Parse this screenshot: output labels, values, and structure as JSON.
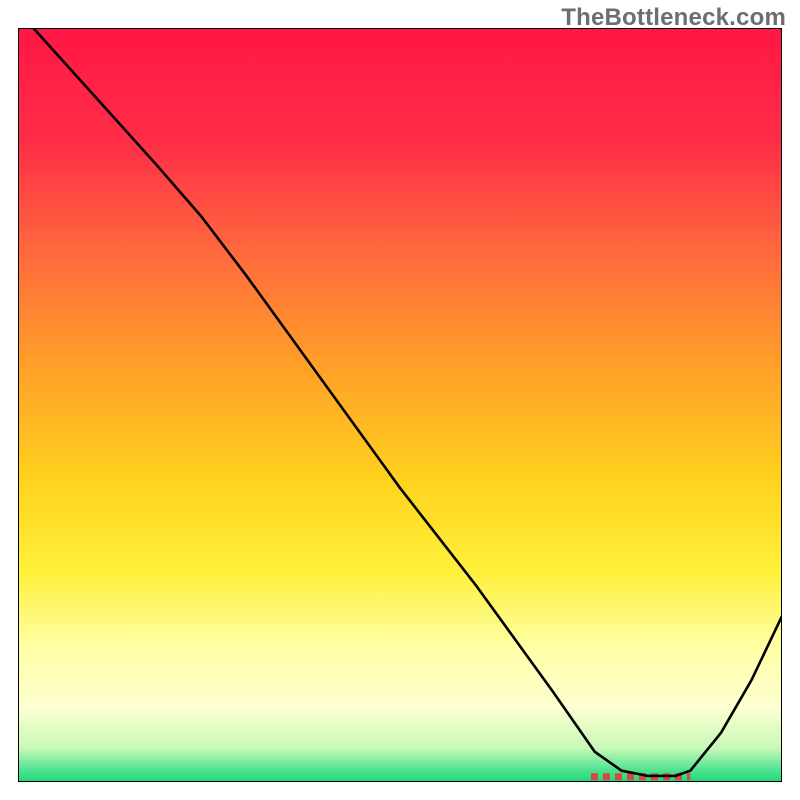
{
  "watermark": "TheBottleneck.com",
  "chart_data": {
    "type": "line",
    "title": "",
    "xlabel": "",
    "ylabel": "",
    "xlim": [
      0,
      100
    ],
    "ylim": [
      0,
      100
    ],
    "grid": false,
    "legend": false,
    "background_gradient": {
      "stops": [
        {
          "offset": 0.0,
          "color": "#ff1744"
        },
        {
          "offset": 0.15,
          "color": "#ff2d47"
        },
        {
          "offset": 0.3,
          "color": "#ff6a3d"
        },
        {
          "offset": 0.45,
          "color": "#ffa028"
        },
        {
          "offset": 0.6,
          "color": "#ffd21f"
        },
        {
          "offset": 0.72,
          "color": "#fff03a"
        },
        {
          "offset": 0.82,
          "color": "#ffffa5"
        },
        {
          "offset": 0.9,
          "color": "#fdffd0"
        },
        {
          "offset": 0.955,
          "color": "#c8f9b8"
        },
        {
          "offset": 0.985,
          "color": "#4be38f"
        },
        {
          "offset": 1.0,
          "color": "#1dd975"
        }
      ]
    },
    "series": [
      {
        "name": "curve",
        "color": "#000000",
        "width": 2.6,
        "x": [
          2.0,
          10.0,
          18.0,
          24.0,
          30.0,
          40.0,
          50.0,
          60.0,
          70.0,
          75.5,
          79.0,
          82.5,
          86.0,
          88.0,
          92.0,
          96.0,
          100.0
        ],
        "y": [
          100.0,
          91.0,
          82.0,
          75.0,
          67.0,
          53.0,
          39.0,
          26.0,
          12.0,
          4.0,
          1.5,
          0.8,
          0.8,
          1.5,
          6.5,
          13.5,
          22.0
        ]
      }
    ],
    "markers": [
      {
        "name": "bottom-red-segment",
        "type": "dashed-line",
        "color": "#d24a45",
        "dash": [
          7,
          5
        ],
        "width": 7,
        "x": [
          75.0,
          88.0
        ],
        "y": [
          0.7,
          0.7
        ]
      }
    ],
    "axes": {
      "show_ticks": false,
      "line_color": "#000000",
      "line_width": 2
    }
  }
}
